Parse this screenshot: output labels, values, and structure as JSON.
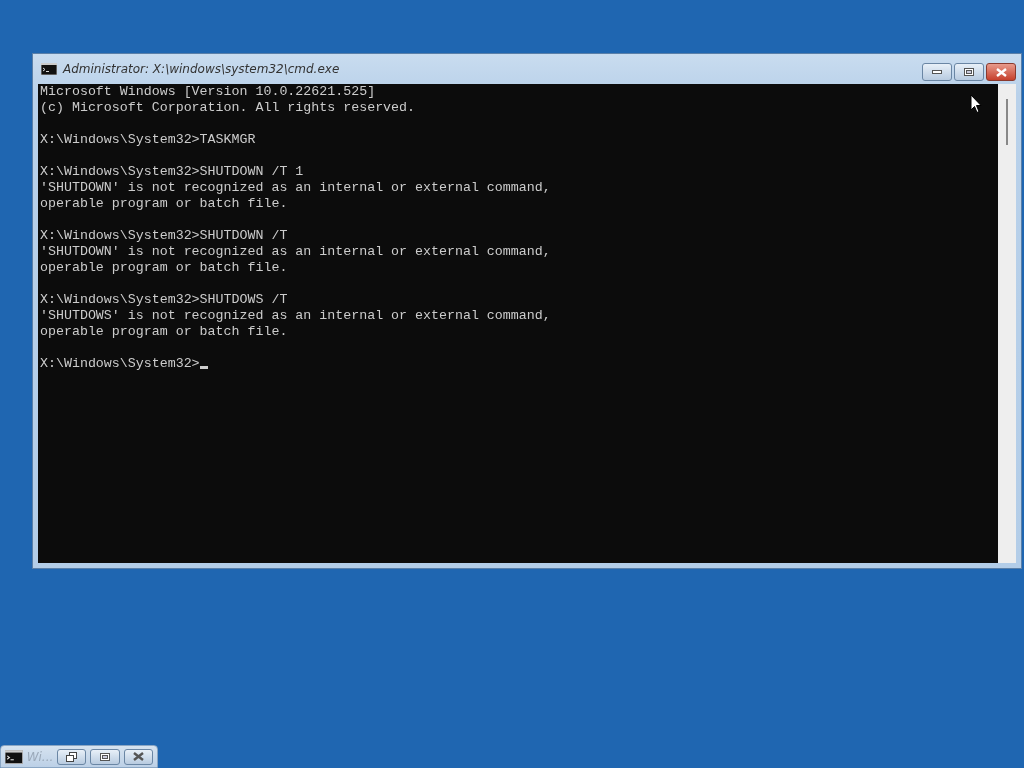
{
  "window": {
    "title": "Administrator: X:\\windows\\system32\\cmd.exe"
  },
  "console": {
    "blocks": [
      [
        "Microsoft Windows [Version 10.0.22621.525]",
        "(c) Microsoft Corporation. All rights reserved."
      ],
      [
        "X:\\Windows\\System32>TASKMGR"
      ],
      [
        "X:\\Windows\\System32>SHUTDOWN /T 1",
        "'SHUTDOWN' is not recognized as an internal or external command,",
        "operable program or batch file."
      ],
      [
        "X:\\Windows\\System32>SHUTDOWN /T",
        "'SHUTDOWN' is not recognized as an internal or external command,",
        "operable program or batch file."
      ],
      [
        "X:\\Windows\\System32>SHUTDOWS /T",
        "'SHUTDOWS' is not recognized as an internal or external command,",
        "operable program or batch file."
      ]
    ],
    "prompt": "X:\\Windows\\System32>"
  },
  "minimized_window": {
    "title": "Wi..."
  }
}
